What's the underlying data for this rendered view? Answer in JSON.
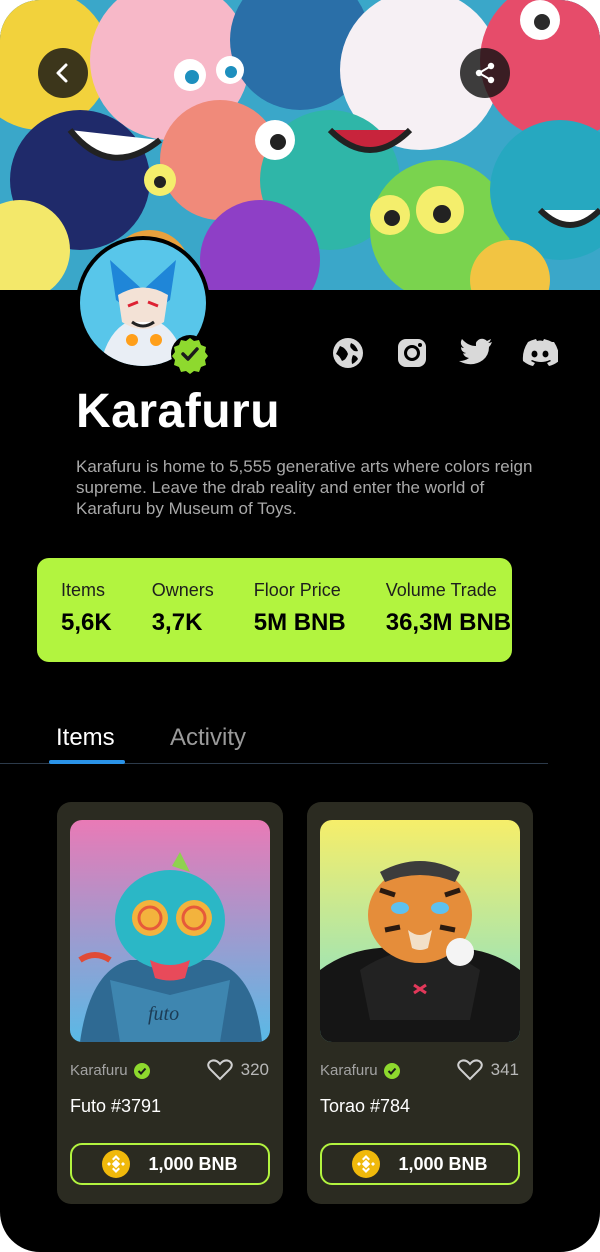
{
  "collection": {
    "name": "Karafuru",
    "description": "Karafuru is home to 5,555 generative arts where colors reign supreme. Leave the drab reality and enter the world of Karafuru by Museum of Toys."
  },
  "social_icons": [
    "globe-icon",
    "instagram-icon",
    "twitter-icon",
    "discord-icon"
  ],
  "stats": [
    {
      "label": "Items",
      "value": "5,6K"
    },
    {
      "label": "Owners",
      "value": "3,7K"
    },
    {
      "label": "Floor Price",
      "value": "5M BNB"
    },
    {
      "label": "Volume Trade",
      "value": "36,3M BNB"
    }
  ],
  "tabs": [
    {
      "label": "Items",
      "active": true
    },
    {
      "label": "Activity",
      "active": false
    }
  ],
  "items": [
    {
      "collection": "Karafuru",
      "likes": "320",
      "name": "Futo #3791",
      "price": "1,000 BNB"
    },
    {
      "collection": "Karafuru",
      "likes": "341",
      "name": "Torao #784",
      "price": "1,000 BNB"
    }
  ],
  "colors": {
    "accent": "#b2f43f",
    "background": "#000000",
    "card": "#2b2b21",
    "tab_indicator": "#2a93e8",
    "bnb": "#f0b90b"
  }
}
